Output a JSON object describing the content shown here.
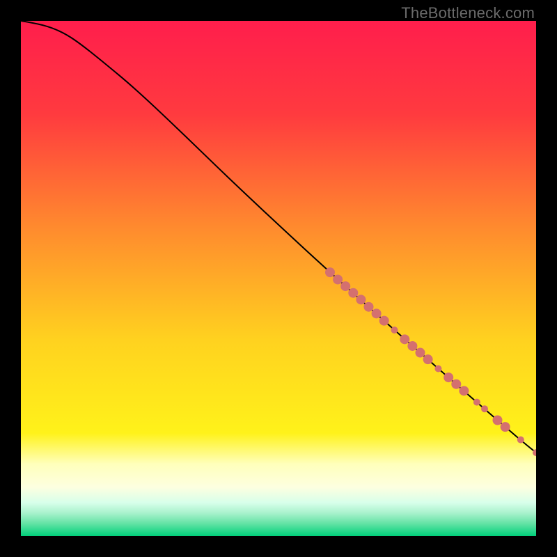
{
  "watermark": "TheBottleneck.com",
  "chart_data": {
    "type": "line",
    "title": "",
    "xlabel": "",
    "ylabel": "",
    "xlim": [
      0,
      100
    ],
    "ylim": [
      0,
      100
    ],
    "gradient_stops": [
      {
        "offset": 0,
        "color": "#ff1e4c"
      },
      {
        "offset": 0.18,
        "color": "#ff3a3f"
      },
      {
        "offset": 0.4,
        "color": "#ff8a2e"
      },
      {
        "offset": 0.62,
        "color": "#ffd21f"
      },
      {
        "offset": 0.8,
        "color": "#fff21a"
      },
      {
        "offset": 0.86,
        "color": "#ffffbb"
      },
      {
        "offset": 0.905,
        "color": "#fdffe0"
      },
      {
        "offset": 0.935,
        "color": "#d8ffea"
      },
      {
        "offset": 0.955,
        "color": "#a9f2cd"
      },
      {
        "offset": 0.975,
        "color": "#66e3a6"
      },
      {
        "offset": 1.0,
        "color": "#00d07a"
      }
    ],
    "series": [
      {
        "name": "curve",
        "x": [
          0,
          3,
          6,
          9,
          12,
          16,
          22,
          30,
          40,
          50,
          60,
          70,
          80,
          88,
          94,
          98,
          100
        ],
        "y": [
          100,
          99.5,
          98.7,
          97.3,
          95.2,
          92.0,
          87.0,
          79.5,
          69.8,
          60.4,
          51.2,
          42.2,
          33.4,
          26.4,
          21.2,
          17.8,
          16.2
        ]
      }
    ],
    "points": {
      "name": "markers",
      "color": "#d4706f",
      "r_large": 7,
      "r_small": 5,
      "coords": [
        {
          "x": 60.0,
          "y": 51.2,
          "r": "l"
        },
        {
          "x": 61.5,
          "y": 49.8,
          "r": "l"
        },
        {
          "x": 63.0,
          "y": 48.5,
          "r": "l"
        },
        {
          "x": 64.5,
          "y": 47.2,
          "r": "l"
        },
        {
          "x": 66.0,
          "y": 45.9,
          "r": "l"
        },
        {
          "x": 67.5,
          "y": 44.5,
          "r": "l"
        },
        {
          "x": 69.0,
          "y": 43.2,
          "r": "l"
        },
        {
          "x": 70.5,
          "y": 41.8,
          "r": "l"
        },
        {
          "x": 72.5,
          "y": 40.0,
          "r": "s"
        },
        {
          "x": 74.5,
          "y": 38.2,
          "r": "l"
        },
        {
          "x": 76.0,
          "y": 36.9,
          "r": "l"
        },
        {
          "x": 77.5,
          "y": 35.6,
          "r": "l"
        },
        {
          "x": 79.0,
          "y": 34.3,
          "r": "l"
        },
        {
          "x": 81.0,
          "y": 32.5,
          "r": "s"
        },
        {
          "x": 83.0,
          "y": 30.8,
          "r": "l"
        },
        {
          "x": 84.5,
          "y": 29.5,
          "r": "l"
        },
        {
          "x": 86.0,
          "y": 28.2,
          "r": "l"
        },
        {
          "x": 88.5,
          "y": 26.0,
          "r": "s"
        },
        {
          "x": 90.0,
          "y": 24.7,
          "r": "s"
        },
        {
          "x": 92.5,
          "y": 22.5,
          "r": "l"
        },
        {
          "x": 94.0,
          "y": 21.2,
          "r": "l"
        },
        {
          "x": 97.0,
          "y": 18.7,
          "r": "s"
        },
        {
          "x": 100.0,
          "y": 16.2,
          "r": "s"
        }
      ]
    }
  }
}
